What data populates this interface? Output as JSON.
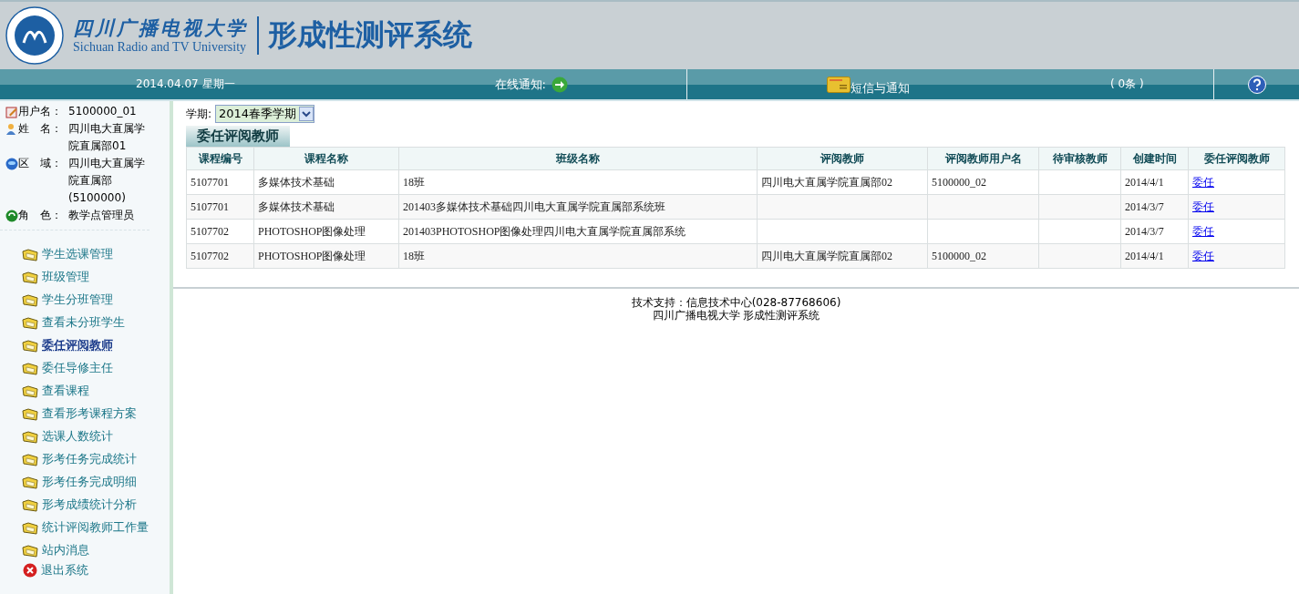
{
  "header": {
    "university_cn": "四川广播电视大学",
    "university_en": "Sichuan Radio and TV University",
    "system_title": "形成性测评系统"
  },
  "nav_bar": {
    "date": "2014.04.07 星期一",
    "online_notice": "在线通知:",
    "messages": "短信与通知",
    "message_count": "( 0条 )"
  },
  "user_info": [
    {
      "kind": "user",
      "label": "用户名：",
      "value": "5100000_01"
    },
    {
      "kind": "person",
      "label": "姓　名：",
      "value": "四川电大直属学院直属部01"
    },
    {
      "kind": "globe",
      "label": "区　域：",
      "value": "四川电大直属学院直属部(5100000)"
    },
    {
      "kind": "role",
      "label": "角　色：",
      "value": "教学点管理员"
    }
  ],
  "menu": [
    {
      "label": "学生选课管理",
      "selected": false,
      "kind": "folder"
    },
    {
      "label": "班级管理",
      "selected": false,
      "kind": "folder"
    },
    {
      "label": "学生分班管理",
      "selected": false,
      "kind": "folder"
    },
    {
      "label": "查看未分班学生",
      "selected": false,
      "kind": "folder"
    },
    {
      "label": "委任评阅教师",
      "selected": true,
      "kind": "folder"
    },
    {
      "label": "委任导修主任",
      "selected": false,
      "kind": "folder"
    },
    {
      "label": "查看课程",
      "selected": false,
      "kind": "folder"
    },
    {
      "label": "查看形考课程方案",
      "selected": false,
      "kind": "folder"
    },
    {
      "label": "选课人数统计",
      "selected": false,
      "kind": "folder"
    },
    {
      "label": "形考任务完成统计",
      "selected": false,
      "kind": "folder"
    },
    {
      "label": "形考任务完成明细",
      "selected": false,
      "kind": "folder"
    },
    {
      "label": "形考成绩统计分析",
      "selected": false,
      "kind": "folder"
    },
    {
      "label": "统计评阅教师工作量",
      "selected": false,
      "kind": "folder"
    },
    {
      "label": "站内消息",
      "selected": false,
      "kind": "folder"
    },
    {
      "label": "退出系统",
      "selected": false,
      "kind": "exit"
    }
  ],
  "term": {
    "label": "学期:",
    "value": "2014春季学期"
  },
  "section_title": "委任评阅教师",
  "table": {
    "columns": [
      "课程编号",
      "课程名称",
      "班级名称",
      "评阅教师",
      "评阅教师用户名",
      "待审核教师",
      "创建时间",
      "委任评阅教师"
    ],
    "rows": [
      [
        "5107701",
        "多媒体技术基础",
        "18班",
        "四川电大直属学院直属部02",
        "5100000_02",
        "",
        "2014/4/1",
        "委任"
      ],
      [
        "5107701",
        "多媒体技术基础",
        "201403多媒体技术基础四川电大直属学院直属部系统班",
        "",
        "",
        "",
        "2014/3/7",
        "委任"
      ],
      [
        "5107702",
        "PHOTOSHOP图像处理",
        "201403PHOTOSHOP图像处理四川电大直属学院直属部系统",
        "",
        "",
        "",
        "2014/3/7",
        "委任"
      ],
      [
        "5107702",
        "PHOTOSHOP图像处理",
        "18班",
        "四川电大直属学院直属部02",
        "5100000_02",
        "",
        "2014/4/1",
        "委任"
      ]
    ]
  },
  "footer": {
    "support": "技术支持：信息技术中心(028-87768606)",
    "system": "四川广播电视大学  形成性测评系统"
  }
}
